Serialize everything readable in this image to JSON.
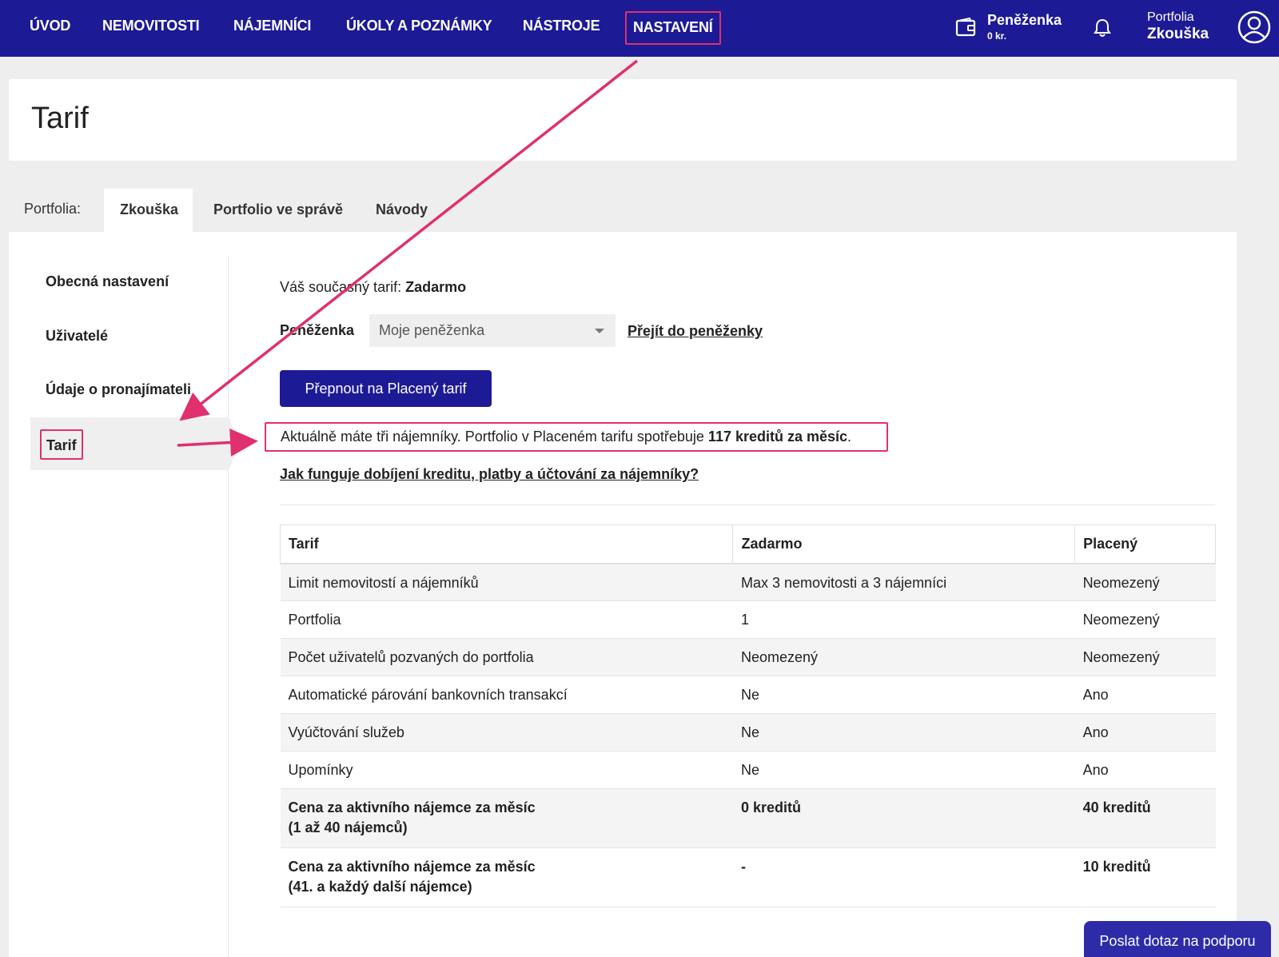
{
  "nav": {
    "items": [
      "ÚVOD",
      "NEMOVITOSTI",
      "NÁJEMNÍCI",
      "ÚKOLY A POZNÁMKY",
      "NÁSTROJE",
      "NASTAVENÍ"
    ],
    "wallet_title": "Peněženka",
    "wallet_amount": "0 kr.",
    "portfolio_label": "Portfolia",
    "portfolio_value": "Zkouška",
    "icons": {
      "wallet": "wallet-icon",
      "bell": "bell-icon",
      "avatar": "user-avatar-icon"
    }
  },
  "page_title": "Tarif",
  "tabs": {
    "label": "Portfolia:",
    "items": [
      "Zkouška",
      "Portfolio ve správě",
      "Návody"
    ]
  },
  "sidebar": {
    "items": [
      "Obecná nastavení",
      "Uživatelé",
      "Údaje o pronajímateli",
      "Tarif"
    ]
  },
  "content": {
    "current_plan_label": "Váš současný tarif:",
    "current_plan_value": "Zadarmo",
    "wallet_label": "Peněženka",
    "wallet_select_value": "Moje peněženka",
    "wallet_link": "Přejít do peněženky",
    "switch_button": "Přepnout na Placený tarif",
    "info_text": "Aktuálně máte tři nájemníky. Portfolio v Placeném tarifu spotřebuje ",
    "info_bold": "117 kreditů za měsíc",
    "info_end": ".",
    "help_link": "Jak funguje dobíjení kreditu, platby a účtování za nájemníky?"
  },
  "table": {
    "headers": [
      "Tarif",
      "Zadarmo",
      "Placený"
    ],
    "rows": [
      [
        "Limit nemovitostí a nájemníků",
        "Max 3 nemovitosti a 3 nájemníci",
        "Neomezený"
      ],
      [
        "Portfolia",
        "1",
        "Neomezený"
      ],
      [
        "Počet uživatelů pozvaných do portfolia",
        "Neomezený",
        "Neomezený"
      ],
      [
        "Automatické párování bankovních transakcí",
        "Ne",
        "Ano"
      ],
      [
        "Vyúčtování služeb",
        "Ne",
        "Ano"
      ],
      [
        "Upomínky",
        "Ne",
        "Ano"
      ]
    ],
    "price_rows": [
      {
        "label_1": "Cena za aktivního nájemce za měsíc",
        "label_2": "(1 až 40 nájemců)",
        "free": "0 kreditů",
        "paid": "40 kreditů"
      },
      {
        "label_1": "Cena za aktivního nájemce za měsíc",
        "label_2": "(41. a každý další nájemce)",
        "free": "-",
        "paid": "10 kreditů"
      }
    ]
  },
  "support_button": "Poslat dotaz na podporu",
  "colors": {
    "primary": "#1c1a94",
    "highlight": "#e0306e"
  }
}
